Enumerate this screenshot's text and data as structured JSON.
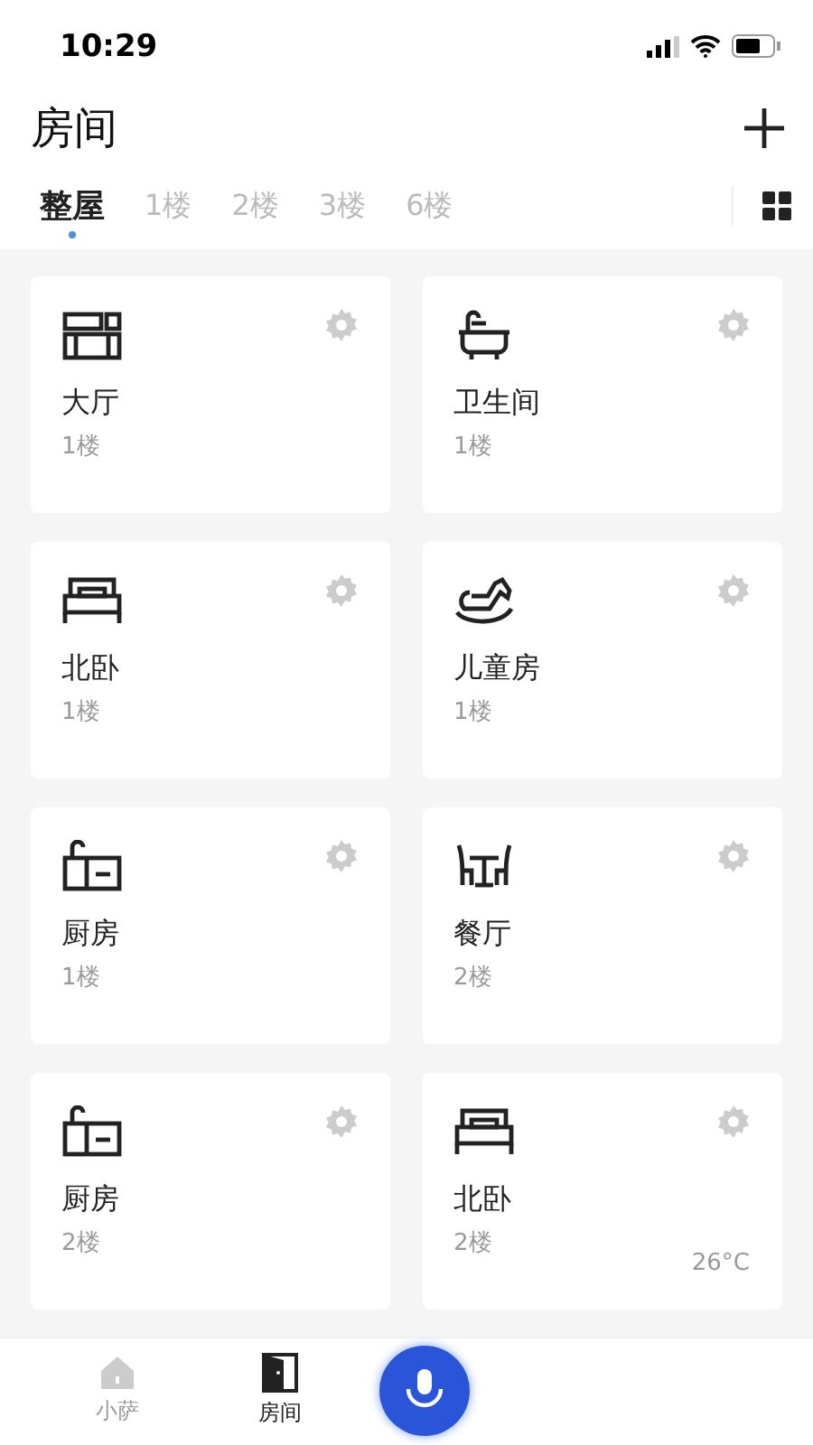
{
  "status_bar": {
    "time": "10:29"
  },
  "header": {
    "title": "房间"
  },
  "tabs": [
    {
      "label": "整屋",
      "selected": true
    },
    {
      "label": "1楼",
      "selected": false
    },
    {
      "label": "2楼",
      "selected": false
    },
    {
      "label": "3楼",
      "selected": false
    },
    {
      "label": "6楼",
      "selected": false
    }
  ],
  "rooms": [
    {
      "kind": "sofa",
      "name": "大厅",
      "floor": "1楼"
    },
    {
      "kind": "bath",
      "name": "卫生间",
      "floor": "1楼"
    },
    {
      "kind": "bed",
      "name": "北卧",
      "floor": "1楼"
    },
    {
      "kind": "horse",
      "name": "儿童房",
      "floor": "1楼"
    },
    {
      "kind": "kitchen",
      "name": "厨房",
      "floor": "1楼"
    },
    {
      "kind": "dining",
      "name": "餐厅",
      "floor": "2楼"
    },
    {
      "kind": "kitchen",
      "name": "厨房",
      "floor": "2楼"
    },
    {
      "kind": "bed",
      "name": "北卧",
      "floor": "2楼",
      "temperature": "26°C"
    }
  ],
  "bottom_nav": [
    {
      "kind": "home",
      "label": "小萨",
      "selected": false
    },
    {
      "kind": "door",
      "label": "房间",
      "selected": true
    },
    {
      "kind": "mic",
      "selected": false
    }
  ]
}
